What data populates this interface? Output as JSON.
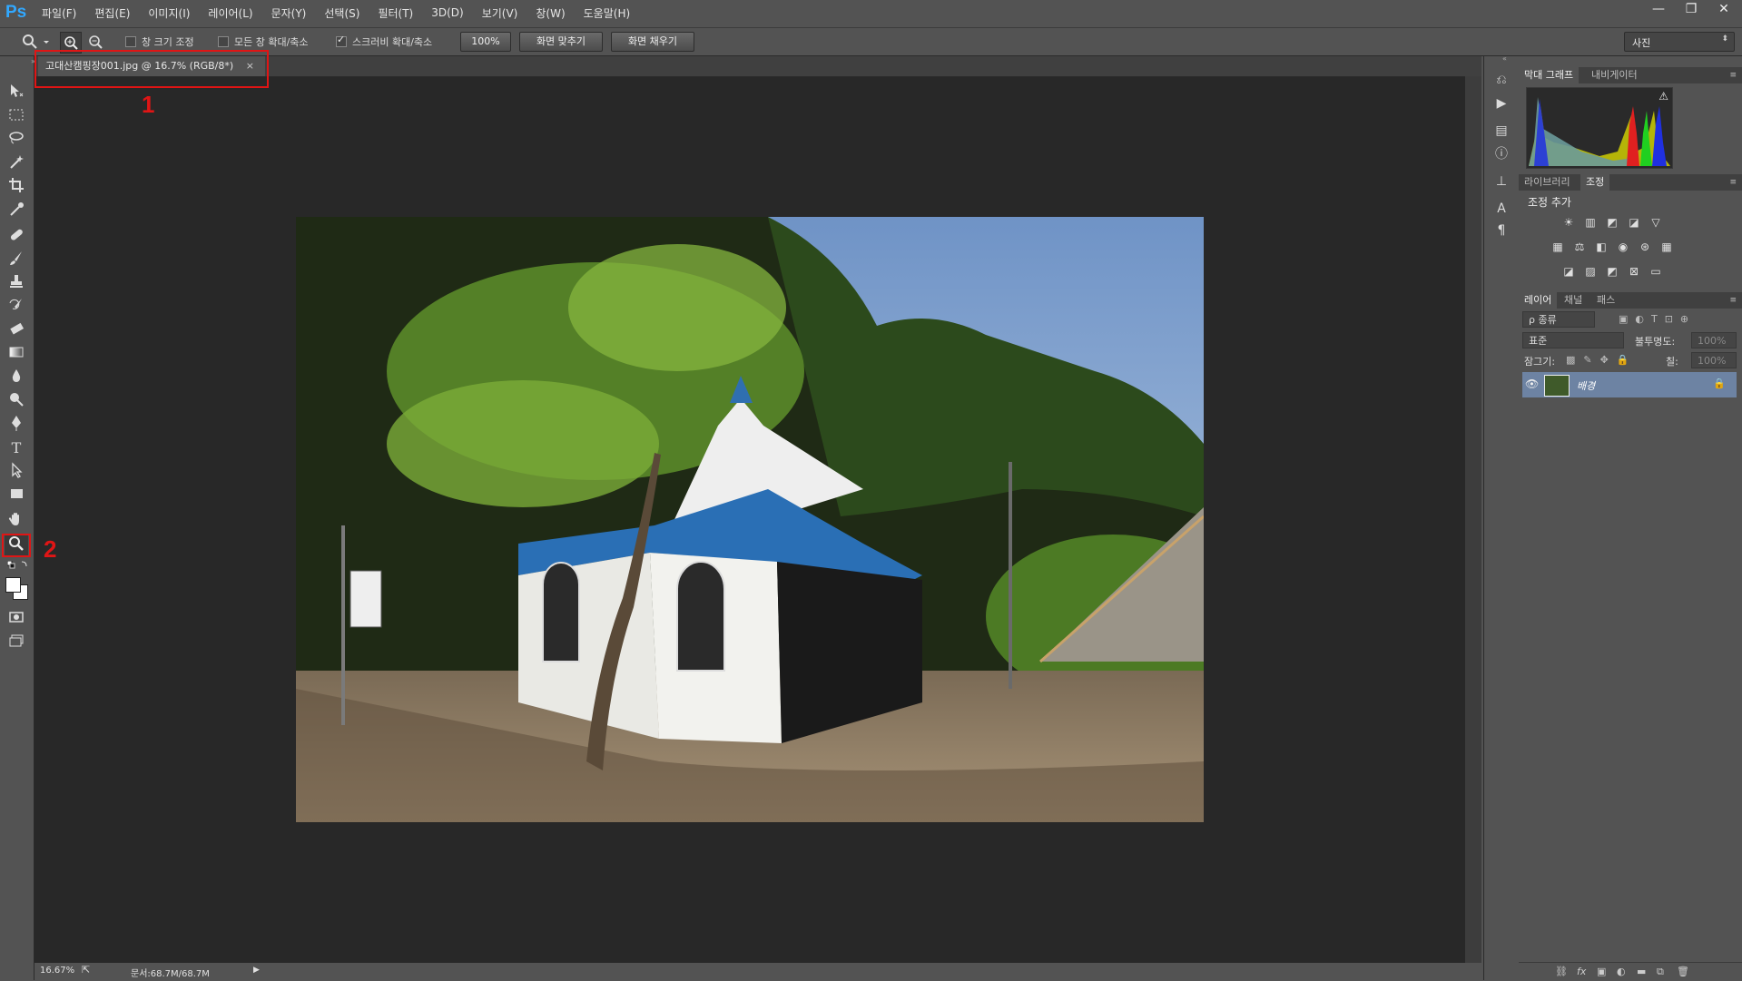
{
  "app": {
    "logo": "Ps"
  },
  "menu": [
    "파일(F)",
    "편집(E)",
    "이미지(I)",
    "레이어(L)",
    "문자(Y)",
    "선택(S)",
    "필터(T)",
    "3D(D)",
    "보기(V)",
    "창(W)",
    "도움말(H)"
  ],
  "window_controls": {
    "minimize": "—",
    "restore": "❐",
    "close": "✕"
  },
  "options": {
    "resize_windows": "창 크기 조정",
    "zoom_all_windows": "모든 창 확대/축소",
    "scrubby_zoom": "스크러비 확대/축소",
    "scrubby_zoom_checked": true,
    "resize_windows_checked": false,
    "zoom_all_windows_checked": false,
    "btn_100": "100%",
    "btn_fit": "화면 맞추기",
    "btn_fill": "화면 채우기",
    "workspace": "사진"
  },
  "document": {
    "tab_title": "고대산캠핑장001.jpg @ 16.7% (RGB/8*)",
    "tab_close": "×"
  },
  "annotations": {
    "label_1": "1",
    "label_2": "2",
    "color": "#e01515"
  },
  "status": {
    "zoom": "16.67%",
    "doc_size": "문서:68.7M/68.7M"
  },
  "panels": {
    "histogram_tabs": [
      "막대 그래프",
      "내비게이터"
    ],
    "adjust_tabs": [
      "라이브러리",
      "조정"
    ],
    "adjust_title": "조정 추가",
    "layer_tabs": [
      "레이어",
      "채널",
      "패스"
    ],
    "layer_filter": "ρ 종류",
    "blend_mode": "표준",
    "opacity_label": "불투명도:",
    "opacity_value": "100%",
    "lock_label": "잠그기:",
    "fill_label": "칠:",
    "fill_value": "100%",
    "layer_name": "배경"
  }
}
